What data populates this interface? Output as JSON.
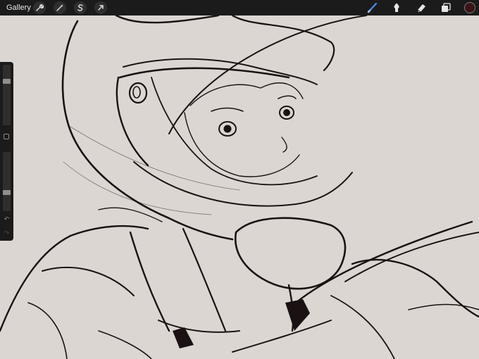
{
  "topbar": {
    "gallery_label": "Gallery",
    "left_tools": [
      {
        "name": "wrench-icon"
      },
      {
        "name": "magic-wand-icon"
      },
      {
        "name": "selection-icon"
      },
      {
        "name": "transform-arrow-icon"
      }
    ],
    "right_tools": [
      {
        "name": "brush-icon",
        "active": true
      },
      {
        "name": "smudge-icon"
      },
      {
        "name": "eraser-icon"
      },
      {
        "name": "layers-icon"
      }
    ],
    "current_color": "#3a1418"
  },
  "sidebar": {
    "brush_size": 0.75,
    "brush_opacity": 0.3,
    "undo_icon": "undo-icon",
    "redo_icon": "redo-icon"
  },
  "colors": {
    "canvas_background": "#dcd6d2",
    "line_color": "#1a1212",
    "ui_dark": "#1b1b1b",
    "active_brush": "#4a8fe6"
  }
}
